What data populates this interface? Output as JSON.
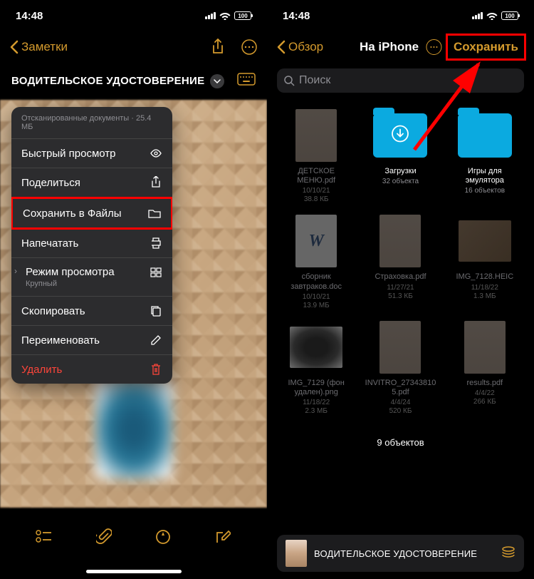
{
  "status": {
    "time": "14:48",
    "battery": "100"
  },
  "left": {
    "back_label": "Заметки",
    "note_title": "ВОДИТЕЛЬСКОЕ УДОСТОВЕРЕНИЕ",
    "menu": {
      "header": "Отсканированные документы · 25.4 МБ",
      "quick_look": "Быстрый просмотр",
      "share": "Поделиться",
      "save_files": "Сохранить в Файлы",
      "print": "Напечатать",
      "view_mode": "Режим просмотра",
      "view_mode_sub": "Крупный",
      "copy": "Скопировать",
      "rename": "Переименовать",
      "delete": "Удалить"
    }
  },
  "right": {
    "back_label": "Обзор",
    "title": "На iPhone",
    "save": "Сохранить",
    "search_placeholder": "Поиск",
    "files": [
      {
        "name": "ДЕТСКОЕ МЕНЮ.pdf",
        "date": "10/10/21",
        "size": "38.8 КБ",
        "type": "pdf"
      },
      {
        "name": "Загрузки",
        "meta": "32 объекта",
        "type": "folder-dl",
        "active": true
      },
      {
        "name": "Игры для эмулятора",
        "meta": "16 объектов",
        "type": "folder",
        "active": true
      },
      {
        "name": "сборник завтраков.doc",
        "date": "10/10/21",
        "size": "13.9 МБ",
        "type": "doc"
      },
      {
        "name": "Страховка.pdf",
        "date": "11/27/21",
        "size": "51.3 КБ",
        "type": "pdf"
      },
      {
        "name": "IMG_7128.HEIC",
        "date": "11/18/22",
        "size": "1.3 МБ",
        "type": "img"
      },
      {
        "name": "IMG_7129 (фон удален).png",
        "date": "11/18/22",
        "size": "2.3 МБ",
        "type": "mouse"
      },
      {
        "name": "INVITRO_27343810 5.pdf",
        "date": "4/4/24",
        "size": "520 КБ",
        "type": "pdf"
      },
      {
        "name": "results.pdf",
        "date": "4/4/22",
        "size": "266 КБ",
        "type": "pdf"
      }
    ],
    "count": "9 объектов",
    "bottom_file": "ВОДИТЕЛЬСКОЕ УДОСТОВЕРЕНИЕ"
  }
}
